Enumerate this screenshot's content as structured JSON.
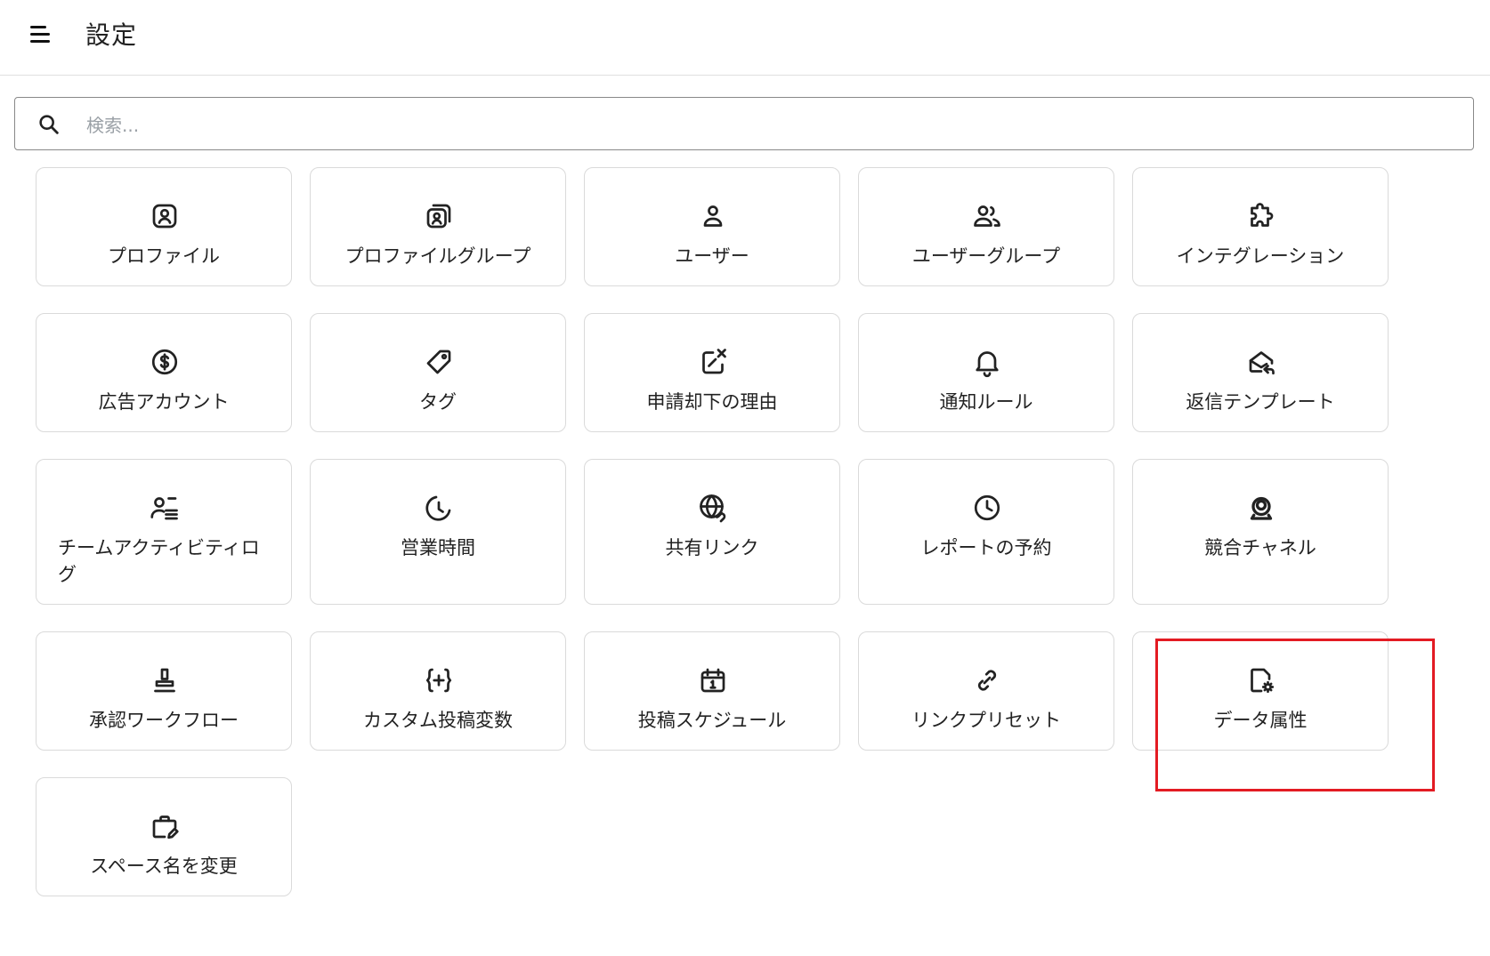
{
  "header": {
    "title": "設定"
  },
  "search": {
    "placeholder": "検索..."
  },
  "cards": [
    {
      "id": "profile",
      "label": "プロファイル",
      "icon": "profile-icon"
    },
    {
      "id": "profile-group",
      "label": "プロファイルグループ",
      "icon": "profile-group-icon"
    },
    {
      "id": "user",
      "label": "ユーザー",
      "icon": "user-icon"
    },
    {
      "id": "user-group",
      "label": "ユーザーグループ",
      "icon": "user-group-icon"
    },
    {
      "id": "integration",
      "label": "インテグレーション",
      "icon": "puzzle-icon"
    },
    {
      "id": "ad-account",
      "label": "広告アカウント",
      "icon": "dollar-icon"
    },
    {
      "id": "tag",
      "label": "タグ",
      "icon": "tag-icon"
    },
    {
      "id": "reject-reason",
      "label": "申請却下の理由",
      "icon": "reject-icon"
    },
    {
      "id": "notification-rule",
      "label": "通知ルール",
      "icon": "bell-icon"
    },
    {
      "id": "reply-template",
      "label": "返信テンプレート",
      "icon": "mail-reply-icon"
    },
    {
      "id": "team-activity-log",
      "label": "チームアクティビティログ",
      "icon": "team-activity-icon"
    },
    {
      "id": "business-hours",
      "label": "営業時間",
      "icon": "moon-clock-icon"
    },
    {
      "id": "shared-link",
      "label": "共有リンク",
      "icon": "globe-link-icon"
    },
    {
      "id": "report-schedule",
      "label": "レポートの予約",
      "icon": "clock-icon"
    },
    {
      "id": "competitor-channel",
      "label": "競合チャネル",
      "icon": "competitor-icon"
    },
    {
      "id": "approval-workflow",
      "label": "承認ワークフロー",
      "icon": "stamp-icon"
    },
    {
      "id": "custom-post-variable",
      "label": "カスタム投稿変数",
      "icon": "braces-plus-icon"
    },
    {
      "id": "post-schedule",
      "label": "投稿スケジュール",
      "icon": "calendar-icon"
    },
    {
      "id": "link-preset",
      "label": "リンクプリセット",
      "icon": "link-icon"
    },
    {
      "id": "data-attribute",
      "label": "データ属性",
      "icon": "file-gear-icon"
    },
    {
      "id": "rename-space",
      "label": "スペース名を変更",
      "icon": "briefcase-edit-icon"
    }
  ],
  "highlighted_card": "data-attribute",
  "colors": {
    "highlight": "#e31b23",
    "card_border": "#dadada",
    "divider": "#e0e0e0"
  }
}
